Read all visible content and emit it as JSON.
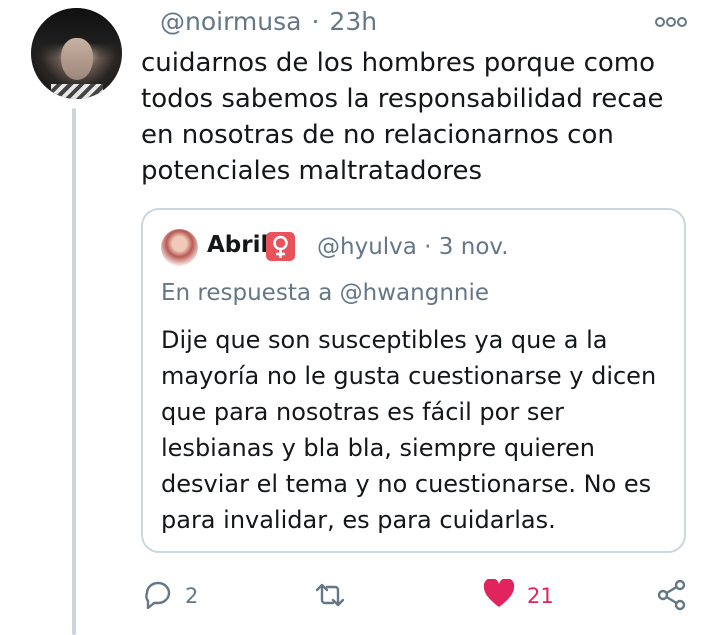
{
  "tweet": {
    "author_handle": "@noirmusa",
    "time": "23h",
    "text": "cuidarnos de los hombres porque como todos sabemos la responsabilidad recae en nosotras de no relacionarnos con potenciales maltratadores"
  },
  "quoted": {
    "name": "Abril",
    "handle_date": "@hyulva · 3 nov.",
    "reply_prefix": "En respuesta a",
    "reply_to": "@hwangnnie",
    "text": "Dije que son susceptibles ya que a la mayoría no le gusta cuestionarse y dicen que para nosotras es fácil por ser lesbianas y bla bla, siempre quieren desviar el tema y no cuestionarse. No es para invalidar, es para cuidarlas."
  },
  "actions": {
    "reply_count": "2",
    "like_count": "21"
  },
  "icons": {
    "more": "more-options-icon",
    "reply": "reply-icon",
    "retweet": "retweet-icon",
    "like": "heart-icon",
    "share": "share-icon",
    "badge": "venus-icon"
  },
  "colors": {
    "like": "#e0245e",
    "muted": "#657786",
    "border": "#ccd6dd"
  }
}
